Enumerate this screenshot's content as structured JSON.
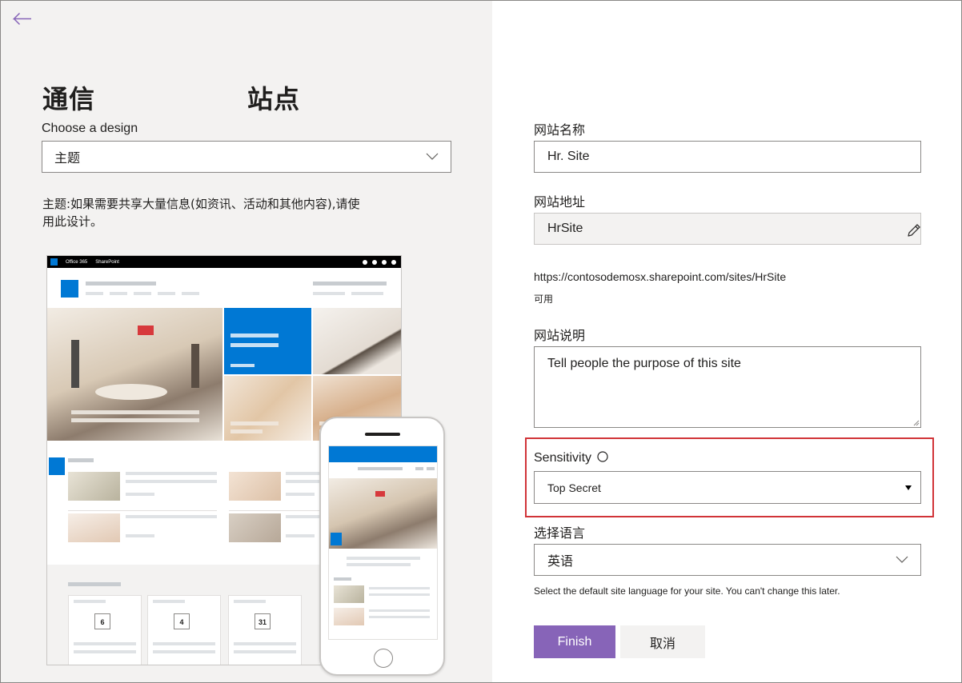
{
  "colors": {
    "accent_purple": "#8764b8",
    "highlight_red": "#d13438",
    "brand_blue": "#0078d4",
    "left_panel_bg": "#f3f2f1"
  },
  "header": {
    "back_icon": "arrow-left-icon",
    "title_part1": "通信",
    "title_part2": "站点"
  },
  "design": {
    "label": "Choose a design",
    "selected": "主题",
    "description": "主题:如果需要共享大量信息(如资讯、活动和其他内容),请使用此设计。",
    "preview": {
      "topbar_office": "Office 365",
      "topbar_app": "SharePoint",
      "calendar_days": [
        "6",
        "4",
        "31"
      ]
    }
  },
  "form": {
    "site_name_label": "网站名称",
    "site_name_value": "Hr. Site",
    "site_address_label": "网站地址",
    "site_address_value": "HrSite",
    "site_url": "https://contosodemosx.sharepoint.com/sites/HrSite",
    "availability": "可用",
    "description_label": "网站说明",
    "description_placeholder": "Tell people the purpose of this site",
    "sensitivity_label": "Sensitivity",
    "sensitivity_info_icon": "info-circle-icon",
    "sensitivity_value": "Top Secret",
    "language_label": "选择语言",
    "language_value": "英语",
    "language_hint": "Select the default site language for your site. You can't change this later."
  },
  "actions": {
    "finish_label": "Finish",
    "cancel_label": "取消"
  }
}
